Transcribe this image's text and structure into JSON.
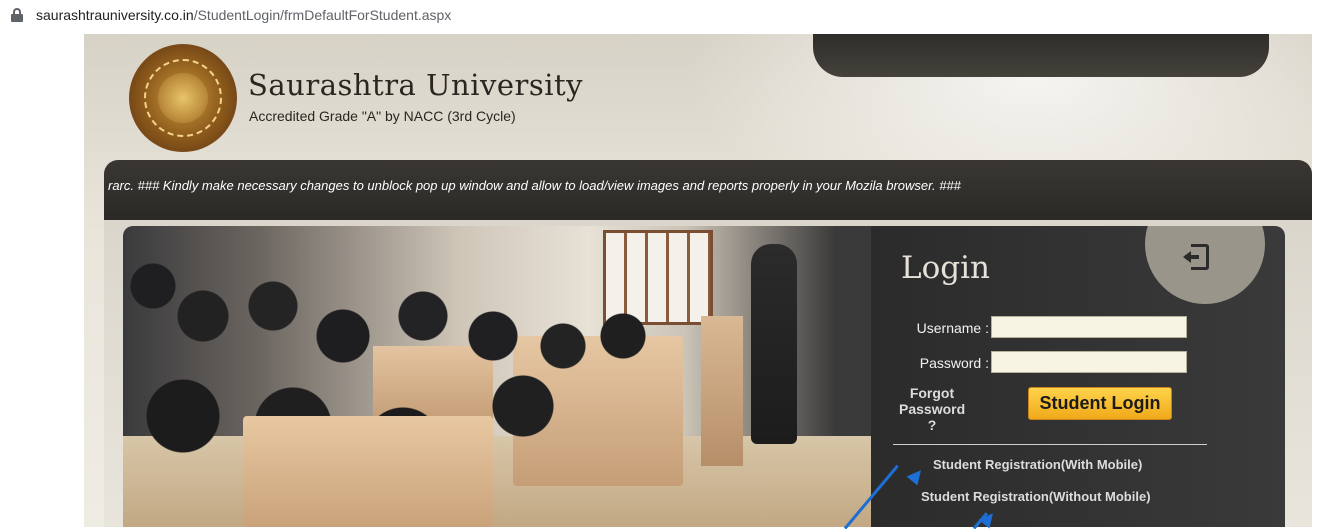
{
  "browser": {
    "url_domain": "saurashtrauniversity.co.in",
    "url_path": "/StudentLogin/frmDefaultForStudent.aspx"
  },
  "header": {
    "title": "Saurashtra University",
    "subtitle": "Accredited Grade \"A\" by NACC (3rd Cycle)"
  },
  "marquee": {
    "text": "rarc. ### Kindly make necessary changes to unblock pop up window and allow to load/view images and reports properly in your Mozila browser. ###"
  },
  "login": {
    "title": "Login",
    "username_label": "Username :",
    "username_value": "",
    "password_label": "Password :",
    "password_value": "",
    "forgot_label": "Forgot Password ?",
    "submit_label": "Student Login",
    "registration_with_mobile": "Student Registration(With Mobile)",
    "registration_without_mobile": "Student Registration(Without Mobile)"
  },
  "colors": {
    "login_button": "#f7c131",
    "annotation_arrow": "#1d6fd6",
    "panel_dark": "#2b2b2b"
  },
  "icons": [
    "lock-icon",
    "login-icon",
    "university-logo"
  ]
}
